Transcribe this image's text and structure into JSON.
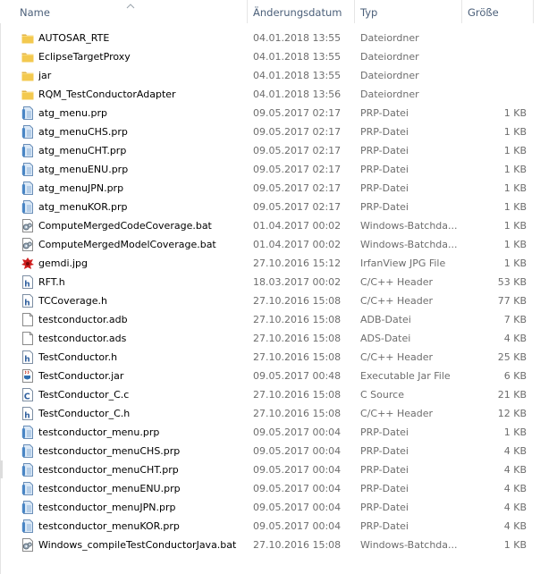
{
  "columns": {
    "name": "Name",
    "date": "Änderungsdatum",
    "type": "Typ",
    "size": "Größe"
  },
  "sort_indicator": "chevron-up-icon",
  "colors": {
    "header_text": "#4c607a",
    "detail_text": "#6d6d6d",
    "folder_yellow": "#f3c94f",
    "prp_blue": "#4a86c5"
  },
  "files": [
    {
      "icon": "folder-icon",
      "name": "AUTOSAR_RTE",
      "date": "04.01.2018 13:55",
      "type": "Dateiordner",
      "size": ""
    },
    {
      "icon": "folder-icon",
      "name": "EclipseTargetProxy",
      "date": "04.01.2018 13:55",
      "type": "Dateiordner",
      "size": ""
    },
    {
      "icon": "folder-icon",
      "name": "jar",
      "date": "04.01.2018 13:55",
      "type": "Dateiordner",
      "size": ""
    },
    {
      "icon": "folder-icon",
      "name": "RQM_TestConductorAdapter",
      "date": "04.01.2018 13:56",
      "type": "Dateiordner",
      "size": ""
    },
    {
      "icon": "prp-file-icon",
      "name": "atg_menu.prp",
      "date": "09.05.2017 02:17",
      "type": "PRP-Datei",
      "size": "1 KB"
    },
    {
      "icon": "prp-file-icon",
      "name": "atg_menuCHS.prp",
      "date": "09.05.2017 02:17",
      "type": "PRP-Datei",
      "size": "1 KB"
    },
    {
      "icon": "prp-file-icon",
      "name": "atg_menuCHT.prp",
      "date": "09.05.2017 02:17",
      "type": "PRP-Datei",
      "size": "1 KB"
    },
    {
      "icon": "prp-file-icon",
      "name": "atg_menuENU.prp",
      "date": "09.05.2017 02:17",
      "type": "PRP-Datei",
      "size": "1 KB"
    },
    {
      "icon": "prp-file-icon",
      "name": "atg_menuJPN.prp",
      "date": "09.05.2017 02:17",
      "type": "PRP-Datei",
      "size": "1 KB"
    },
    {
      "icon": "prp-file-icon",
      "name": "atg_menuKOR.prp",
      "date": "09.05.2017 02:17",
      "type": "PRP-Datei",
      "size": "1 KB"
    },
    {
      "icon": "batch-file-icon",
      "name": "ComputeMergedCodeCoverage.bat",
      "date": "01.04.2017 00:02",
      "type": "Windows-Batchda...",
      "size": "1 KB"
    },
    {
      "icon": "batch-file-icon",
      "name": "ComputeMergedModelCoverage.bat",
      "date": "01.04.2017 00:02",
      "type": "Windows-Batchda...",
      "size": "1 KB"
    },
    {
      "icon": "irfanview-image-icon",
      "name": "gemdi.jpg",
      "date": "27.10.2016 15:12",
      "type": "IrfanView JPG File",
      "size": "1 KB"
    },
    {
      "icon": "header-file-icon",
      "name": "RFT.h",
      "date": "18.03.2017 00:02",
      "type": "C/C++ Header",
      "size": "53 KB"
    },
    {
      "icon": "header-file-icon",
      "name": "TCCoverage.h",
      "date": "27.10.2016 15:08",
      "type": "C/C++ Header",
      "size": "77 KB"
    },
    {
      "icon": "blank-file-icon",
      "name": "testconductor.adb",
      "date": "27.10.2016 15:08",
      "type": "ADB-Datei",
      "size": "7 KB"
    },
    {
      "icon": "blank-file-icon",
      "name": "testconductor.ads",
      "date": "27.10.2016 15:08",
      "type": "ADS-Datei",
      "size": "4 KB"
    },
    {
      "icon": "header-file-icon",
      "name": "TestConductor.h",
      "date": "27.10.2016 15:08",
      "type": "C/C++ Header",
      "size": "25 KB"
    },
    {
      "icon": "jar-file-icon",
      "name": "TestConductor.jar",
      "date": "09.05.2017 00:48",
      "type": "Executable Jar File",
      "size": "6 KB"
    },
    {
      "icon": "c-source-icon",
      "name": "TestConductor_C.c",
      "date": "27.10.2016 15:08",
      "type": "C Source",
      "size": "21 KB"
    },
    {
      "icon": "header-file-icon",
      "name": "TestConductor_C.h",
      "date": "27.10.2016 15:08",
      "type": "C/C++ Header",
      "size": "12 KB"
    },
    {
      "icon": "prp-file-icon",
      "name": "testconductor_menu.prp",
      "date": "09.05.2017 00:04",
      "type": "PRP-Datei",
      "size": "1 KB"
    },
    {
      "icon": "prp-file-icon",
      "name": "testconductor_menuCHS.prp",
      "date": "09.05.2017 00:04",
      "type": "PRP-Datei",
      "size": "4 KB"
    },
    {
      "icon": "prp-file-icon",
      "name": "testconductor_menuCHT.prp",
      "date": "09.05.2017 00:04",
      "type": "PRP-Datei",
      "size": "4 KB"
    },
    {
      "icon": "prp-file-icon",
      "name": "testconductor_menuENU.prp",
      "date": "09.05.2017 00:04",
      "type": "PRP-Datei",
      "size": "4 KB"
    },
    {
      "icon": "prp-file-icon",
      "name": "testconductor_menuJPN.prp",
      "date": "09.05.2017 00:04",
      "type": "PRP-Datei",
      "size": "4 KB"
    },
    {
      "icon": "prp-file-icon",
      "name": "testconductor_menuKOR.prp",
      "date": "09.05.2017 00:04",
      "type": "PRP-Datei",
      "size": "4 KB"
    },
    {
      "icon": "batch-file-icon",
      "name": "Windows_compileTestConductorJava.bat",
      "date": "27.10.2016 15:08",
      "type": "Windows-Batchda...",
      "size": "1 KB"
    }
  ]
}
